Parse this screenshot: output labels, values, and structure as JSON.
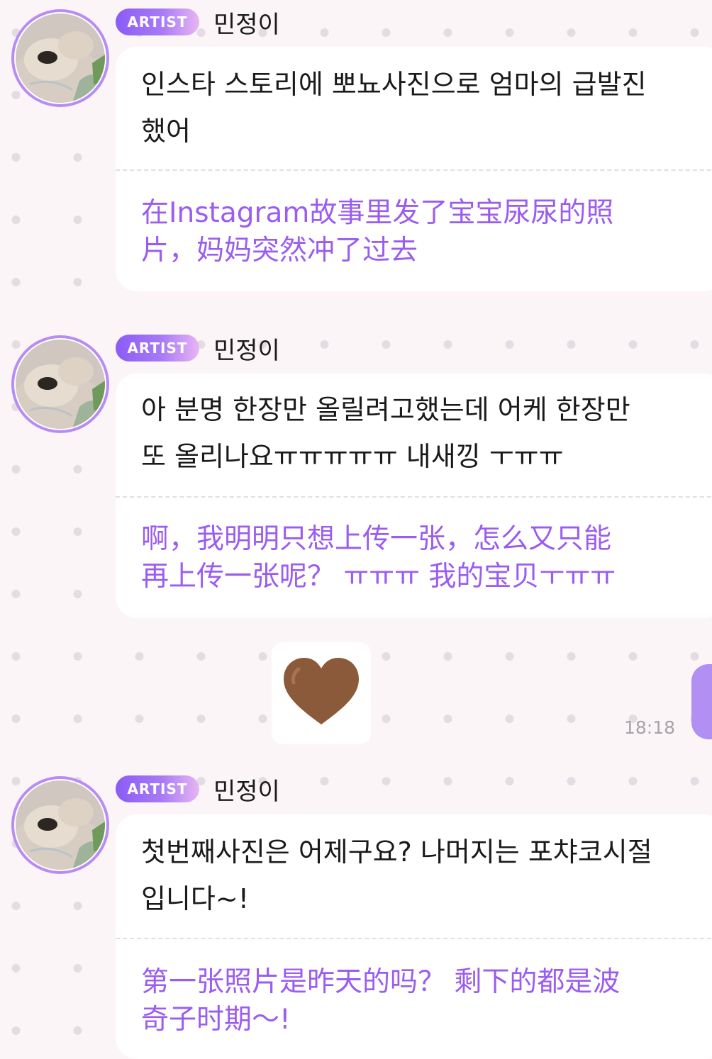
{
  "messages": [
    {
      "badge": "ARTIST",
      "name": "민정이",
      "korean": "인스타 스토리에 뽀뇨사진으로 엄마의 급발진\n했어",
      "chinese": "在Instagram故事里发了宝宝尿尿的照\n片，妈妈突然冲了过去"
    },
    {
      "badge": "ARTIST",
      "name": "민정이",
      "korean": "아 분명 한장만 올릴려고했는데 어케 한장만\n또 올리나요ㅠㅠㅠㅠㅠ 내새낑 ㅜㅠㅠ",
      "chinese": "啊，我明明只想上传一张，怎么又只能\n再上传一张呢？ ㅠㅠㅠ 我的宝贝ㅜㅠㅠ"
    },
    {
      "badge": "ARTIST",
      "name": "민정이",
      "korean": "첫번째사진은 어제구요? 나머지는 포챠코시절\n입니다~!",
      "chinese": "第一张照片是昨天的吗？ 剩下的都是波\n奇子时期～!"
    }
  ],
  "emoji_message": {
    "emoji": "brown-heart",
    "time": "18:18"
  },
  "colors": {
    "accent": "#9b5cf0",
    "avatar_ring": "#b98cf4",
    "badge_start": "#8b5cf6",
    "badge_end": "#e8b5f4",
    "heart": "#8a5a3a",
    "background": "#fbf5f8"
  }
}
